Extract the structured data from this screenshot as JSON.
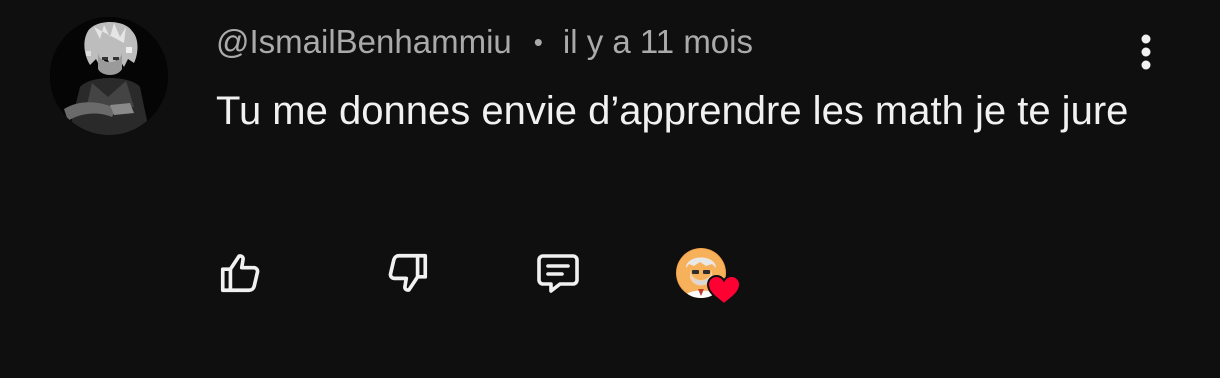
{
  "comment": {
    "author": "@IsmailBenhammiu",
    "separator": "•",
    "timestamp": "il y a 11 mois",
    "text": "Tu me donnes envie d’apprendre les math je te jure"
  },
  "icons": {
    "avatar": "user-avatar-anime",
    "more": "vertical-dots-icon",
    "like": "thumbs-up-icon",
    "dislike": "thumbs-down-icon",
    "reply": "comment-icon",
    "creator_avatar": "creator-avatar",
    "heart": "heart-icon"
  },
  "colors": {
    "background": "#0f0f0f",
    "text_primary": "#f1f1f1",
    "text_secondary": "#aaaaaa",
    "heart": "#ff0033"
  }
}
